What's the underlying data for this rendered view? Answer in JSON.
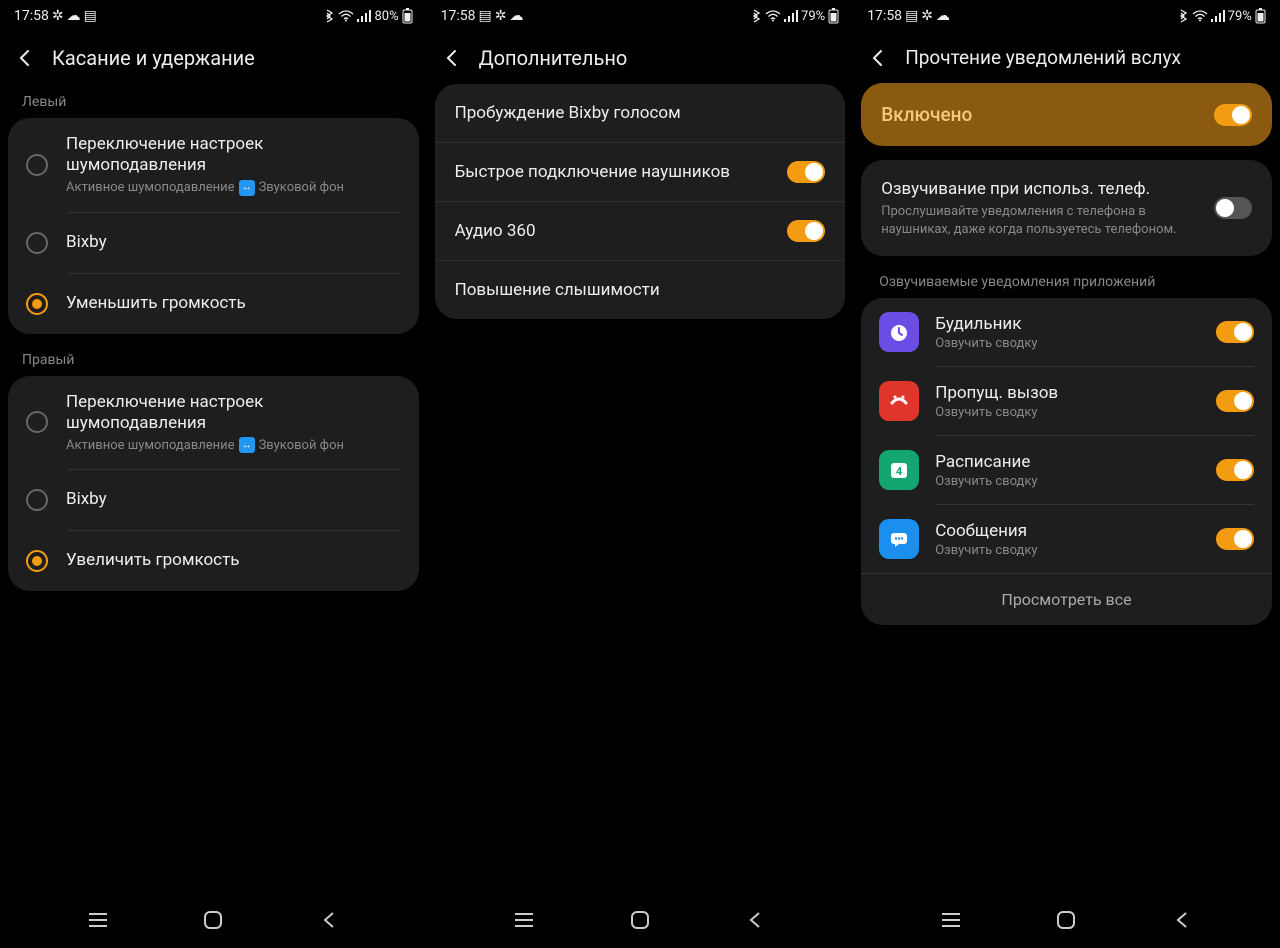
{
  "screens": [
    {
      "status": {
        "time": "17:58",
        "battery": "80%"
      },
      "title": "Касание и удержание",
      "groups": [
        {
          "label": "Левый",
          "items": [
            {
              "title": "Переключение настроек шумоподавления",
              "sub_a": "Активное шумоподавление",
              "sub_b": "Звуковой фон",
              "checked": false
            },
            {
              "title": "Bixby",
              "checked": false
            },
            {
              "title": "Уменьшить громкость",
              "checked": true
            }
          ]
        },
        {
          "label": "Правый",
          "items": [
            {
              "title": "Переключение настроек шумоподавления",
              "sub_a": "Активное шумоподавление",
              "sub_b": "Звуковой фон",
              "checked": false
            },
            {
              "title": "Bixby",
              "checked": false
            },
            {
              "title": "Увеличить громкость",
              "checked": true
            }
          ]
        }
      ]
    },
    {
      "status": {
        "time": "17:58",
        "battery": "79%"
      },
      "title": "Дополнительно",
      "rows": [
        {
          "label": "Пробуждение Bixby голосом",
          "toggle": null
        },
        {
          "label": "Быстрое подключение наушников",
          "toggle": true
        },
        {
          "label": "Аудио 360",
          "toggle": true
        },
        {
          "label": "Повышение слышимости",
          "toggle": null
        }
      ]
    },
    {
      "status": {
        "time": "17:58",
        "battery": "79%"
      },
      "title": "Прочтение уведомлений вслух",
      "master": {
        "label": "Включено",
        "on": true
      },
      "speak_row": {
        "title": "Озвучивание при использ. телеф.",
        "sub": "Прослушивайте уведомления с телефона в наушниках, даже когда пользуетесь телефоном.",
        "on": false
      },
      "apps_label": "Озвучиваемые уведомления приложений",
      "apps": [
        {
          "name": "Будильник",
          "sub": "Озвучить сводку",
          "color": "#6b4de6",
          "glyph": "clock",
          "on": true
        },
        {
          "name": "Пропущ. вызов",
          "sub": "Озвучить сводку",
          "color": "#e0352b",
          "glyph": "phone",
          "on": true
        },
        {
          "name": "Расписание",
          "sub": "Озвучить сводку",
          "color": "#14a670",
          "glyph": "cal",
          "on": true
        },
        {
          "name": "Сообщения",
          "sub": "Озвучить сводку",
          "color": "#1a8ff0",
          "glyph": "msg",
          "on": true
        }
      ],
      "view_all": "Просмотреть все"
    }
  ]
}
